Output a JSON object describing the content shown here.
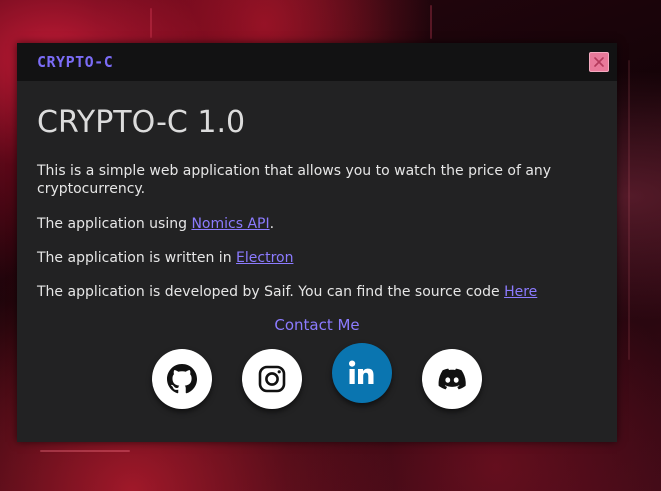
{
  "window": {
    "app_title": "CRYPTO-C",
    "close_icon": "close-icon"
  },
  "content": {
    "heading": "CRYPTO-C 1.0",
    "description": "This is a simple web application that allows you to watch the price of any cryptocurrency.",
    "api_prefix": "The application using ",
    "api_link": "Nomics API",
    "api_suffix": ".",
    "framework_prefix": "The application is written in ",
    "framework_link": "Electron",
    "dev_prefix": "The application is developed by Saif. You can find the source code ",
    "dev_link": "Here",
    "contact_label": "Contact Me"
  },
  "social": [
    {
      "name": "github",
      "icon": "github-icon"
    },
    {
      "name": "instagram",
      "icon": "instagram-icon"
    },
    {
      "name": "linkedin",
      "icon": "linkedin-icon"
    },
    {
      "name": "discord",
      "icon": "discord-icon"
    }
  ],
  "colors": {
    "accent": "#8c7bff",
    "title_accent": "#7b6cf6",
    "window_bg": "#222223",
    "titlebar_bg": "#121213",
    "close_button": "#e8799a",
    "linkedin_blue": "#0a75b0"
  }
}
